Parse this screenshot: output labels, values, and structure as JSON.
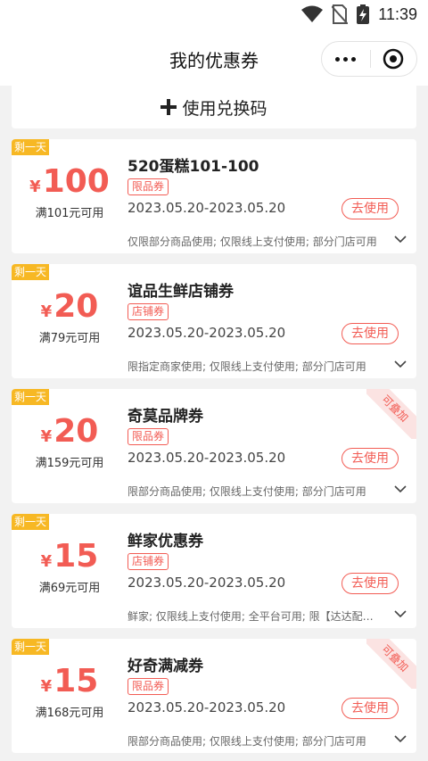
{
  "status_bar": {
    "time": "11:39"
  },
  "nav": {
    "title": "我的优惠券"
  },
  "redeem": {
    "label": "使用兑换码"
  },
  "coupons": [
    {
      "tag": "剩一天",
      "currency": "¥",
      "amount": "100",
      "min_spend": "满101元可用",
      "title": "520蛋糕101-100",
      "type": "限品券",
      "date": "2023.05.20-2023.05.20",
      "action": "去使用",
      "desc": "仅限部分商品使用; 仅限线上支付使用; 部分门店可用",
      "stackable": ""
    },
    {
      "tag": "剩一天",
      "currency": "¥",
      "amount": "20",
      "min_spend": "满79元可用",
      "title": "谊品生鲜店铺券",
      "type": "店铺券",
      "date": "2023.05.20-2023.05.20",
      "action": "去使用",
      "desc": "限指定商家使用; 仅限线上支付使用; 部分门店可用",
      "stackable": ""
    },
    {
      "tag": "剩一天",
      "currency": "¥",
      "amount": "20",
      "min_spend": "满159元可用",
      "title": "奇莫品牌券",
      "type": "限品券",
      "date": "2023.05.20-2023.05.20",
      "action": "去使用",
      "desc": "限部分商品使用; 仅限线上支付使用; 部分门店可用",
      "stackable": "可叠加"
    },
    {
      "tag": "剩一天",
      "currency": "¥",
      "amount": "15",
      "min_spend": "满69元可用",
      "title": "鲜家优惠券",
      "type": "店铺券",
      "date": "2023.05.20-2023.05.20",
      "action": "去使用",
      "desc": "鲜家; 仅限线上支付使用; 全平台可用; 限【达达配送】",
      "stackable": ""
    },
    {
      "tag": "剩一天",
      "currency": "¥",
      "amount": "15",
      "min_spend": "满168元可用",
      "title": "好奇满减券",
      "type": "限品券",
      "date": "2023.05.20-2023.05.20",
      "action": "去使用",
      "desc": "限部分商品使用; 仅限线上支付使用; 部分门店可用",
      "stackable": "可叠加"
    }
  ]
}
